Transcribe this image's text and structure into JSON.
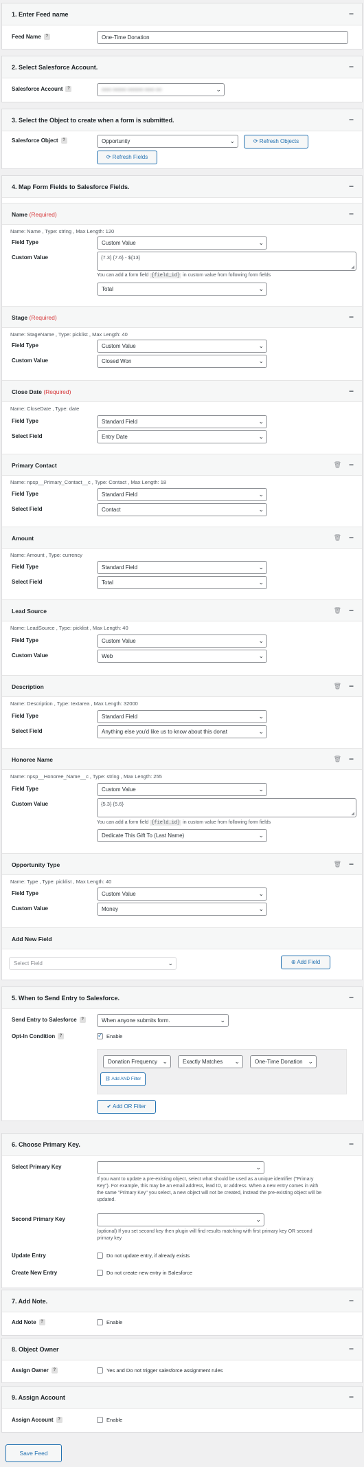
{
  "s1": {
    "title": "1. Enter Feed name",
    "feed_name_label": "Feed Name",
    "feed_name_value": "One-Time Donation"
  },
  "s2": {
    "title": "2. Select Salesforce Account.",
    "account_label": "Salesforce Account",
    "account_value": "••••• ••••••• •••••••• ••••• •••"
  },
  "s3": {
    "title": "3. Select the Object to create when a form is submitted.",
    "object_label": "Salesforce Object",
    "object_value": "Opportunity",
    "refresh_objects": "Refresh Objects",
    "refresh_fields": "Refresh Fields"
  },
  "s4": {
    "title": "4. Map Form Fields to Salesforce Fields.",
    "field_type_label": "Field Type",
    "custom_value_label": "Custom Value",
    "select_field_label": "Select Field",
    "required": "(Required)",
    "hint_prefix": "You can add a form field",
    "hint_code": "{field_id}",
    "hint_suffix": "in custom value from following form fields",
    "fields": [
      {
        "name": "Name",
        "meta": "Name: Name , Type: string , Max Length: 120",
        "type": "Custom Value",
        "value": "{7.3} {7.6} - ${13}",
        "extra": "Total"
      },
      {
        "name": "Stage",
        "meta": "Name: StageName , Type: picklist , Max Length: 40",
        "type": "Custom Value",
        "value": "Closed Won"
      },
      {
        "name": "Close Date",
        "meta": "Name: CloseDate , Type: date",
        "type": "Standard Field",
        "value": "Entry Date"
      },
      {
        "name": "Primary Contact",
        "meta": "Name: npsp__Primary_Contact__c , Type: Contact , Max Length: 18",
        "type": "Standard Field",
        "value": "Contact"
      },
      {
        "name": "Amount",
        "meta": "Name: Amount , Type: currency",
        "type": "Standard Field",
        "value": "Total"
      },
      {
        "name": "Lead Source",
        "meta": "Name: LeadSource , Type: picklist , Max Length: 40",
        "type": "Custom Value",
        "value": "Web"
      },
      {
        "name": "Description",
        "meta": "Name: Description , Type: textarea , Max Length: 32000",
        "type": "Standard Field",
        "value": "Anything else you'd like us to know about this donat"
      },
      {
        "name": "Honoree Name",
        "meta": "Name: npsp__Honoree_Name__c , Type: string , Max Length: 255",
        "type": "Custom Value",
        "value": "{5.3} {5.6}",
        "extra": "Dedicate This Gift To (Last Name)"
      },
      {
        "name": "Opportunity Type",
        "meta": "Name: Type , Type: picklist , Max Length: 40",
        "type": "Custom Value",
        "value": "Money"
      }
    ],
    "add_new_field_title": "Add New Field",
    "select_field_placeholder": "Select Field",
    "add_field_button": "Add Field"
  },
  "s5": {
    "title": "5. When to Send Entry to Salesforce.",
    "send_label": "Send Entry to Salesforce",
    "send_value": "When anyone submits form.",
    "optin_label": "Opt-In Condition",
    "enable": "Enable",
    "filter_field": "Donation Frequency",
    "filter_op": "Exactly Matches",
    "filter_value": "One-Time Donation",
    "add_and": "Add AND Filter",
    "add_or": "Add OR Filter"
  },
  "s6": {
    "title": "6. Choose Primary Key.",
    "primary_label": "Select Primary Key",
    "primary_hint": "If you want to update a pre-existing object, select what should be used as a unique identifier (\"Primary Key\"). For example, this may be an email address, lead ID, or address. When a new entry comes in with the same \"Primary Key\" you select, a new object will not be created, instead the pre-existing object will be updated.",
    "second_label": "Second Primary Key",
    "second_hint": "(optional) If you set second key then plugin will find results matching with first primary key OR second primary key",
    "update_label": "Update Entry",
    "update_cb": "Do not update entry, if already exists",
    "create_label": "Create New Entry",
    "create_cb": "Do not create new entry in Salesforce"
  },
  "s7": {
    "title": "7. Add Note.",
    "note_label": "Add Note",
    "enable": "Enable"
  },
  "s8": {
    "title": "8. Object Owner",
    "owner_label": "Assign Owner",
    "owner_cb": "Yes and Do not trigger salesforce assignment rules"
  },
  "s9": {
    "title": "9. Assign Account",
    "account_label": "Assign Account",
    "enable": "Enable"
  },
  "save_button": "Save Feed"
}
